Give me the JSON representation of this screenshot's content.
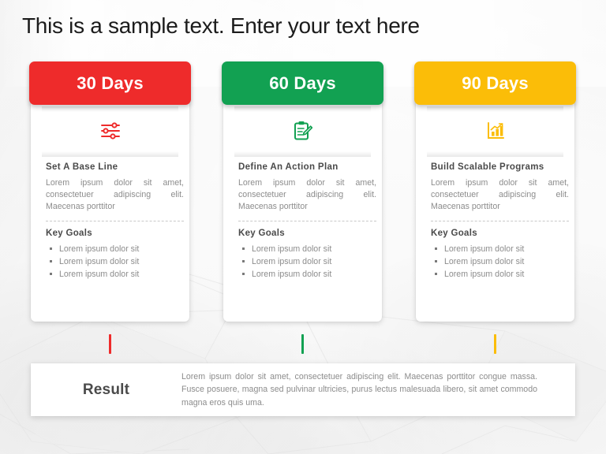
{
  "page": {
    "title": "This is a sample text. Enter your text here"
  },
  "colors": {
    "red": "#EE2B2B",
    "green": "#12A152",
    "yellow": "#FBBD08",
    "heading_text": "#4a4a4a",
    "body_text": "#8c8c8c"
  },
  "cards": [
    {
      "badge": "30 Days",
      "color": "#EE2B2B",
      "icon": "sliders-icon",
      "heading": "Set A Base Line",
      "paragraph": "Lorem ipsum dolor sit amet, consectetuer adipiscing elit. Maecenas porttitor",
      "goals_title": "Key Goals",
      "goals": [
        "Lorem ipsum dolor sit",
        "Lorem ipsum dolor sit",
        "Lorem ipsum dolor sit"
      ]
    },
    {
      "badge": "60 Days",
      "color": "#12A152",
      "icon": "clipboard-pencil-icon",
      "heading": "Define An Action Plan",
      "paragraph": "Lorem ipsum dolor sit amet, consectetuer adipiscing elit. Maecenas porttitor",
      "goals_title": "Key Goals",
      "goals": [
        "Lorem ipsum dolor sit",
        "Lorem ipsum dolor sit",
        "Lorem ipsum dolor sit"
      ]
    },
    {
      "badge": "90 Days",
      "color": "#FBBD08",
      "icon": "bar-chart-icon",
      "heading": "Build Scalable Programs",
      "paragraph": "Lorem ipsum dolor sit amet, consectetuer adipiscing elit. Maecenas porttitor",
      "goals_title": "Key Goals",
      "goals": [
        "Lorem ipsum dolor sit",
        "Lorem ipsum dolor sit",
        "Lorem ipsum dolor sit"
      ]
    }
  ],
  "result": {
    "label": "Result",
    "text": "Lorem ipsum dolor sit amet, consectetuer adipiscing elit. Maecenas porttitor congue massa. Fusce posuere, magna sed pulvinar ultricies, purus lectus malesuada libero, sit amet commodo magna eros quis uma."
  }
}
